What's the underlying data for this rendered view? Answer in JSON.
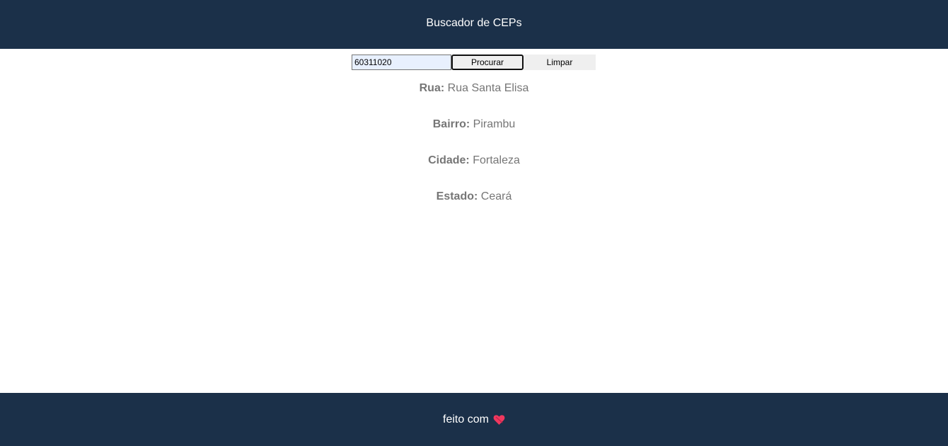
{
  "header": {
    "title": "Buscador de CEPs"
  },
  "search": {
    "input_value": "60311020",
    "search_label": "Procurar",
    "clear_label": "Limpar"
  },
  "results": [
    {
      "label": "Rua:",
      "value": "Rua Santa Elisa"
    },
    {
      "label": "Bairro:",
      "value": "Pirambu"
    },
    {
      "label": "Cidade:",
      "value": "Fortaleza"
    },
    {
      "label": "Estado:",
      "value": "Ceará"
    }
  ],
  "footer": {
    "text": "feito com",
    "icon": "heart-icon",
    "icon_color": "#f0385e"
  },
  "colors": {
    "bar_bg": "#1b3049",
    "result_text": "#767676"
  }
}
